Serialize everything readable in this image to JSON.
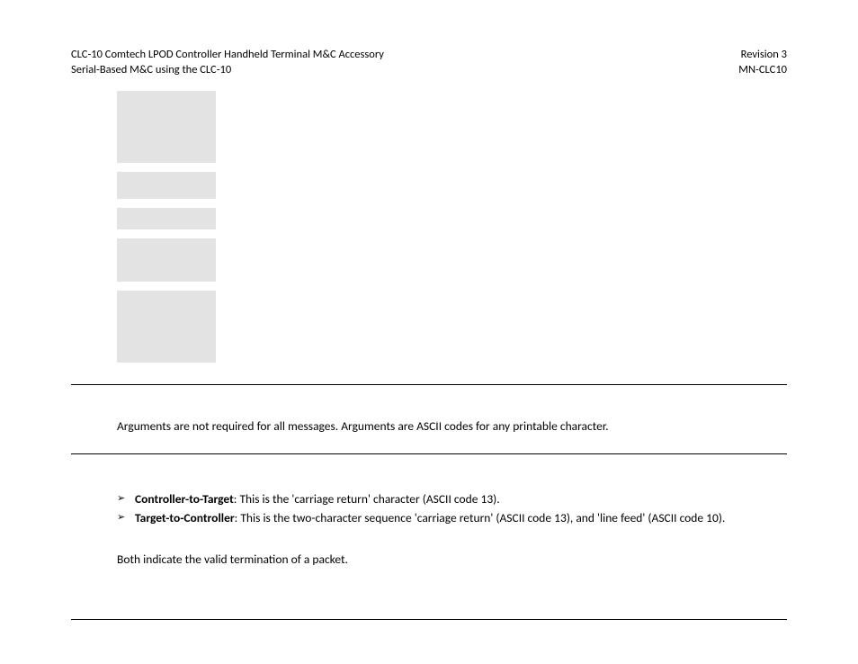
{
  "header": {
    "left_line1": "CLC-10 Comtech LPOD Controller Handheld Terminal M&C Accessory",
    "left_line2": "Serial-Based M&C using the CLC-10",
    "right_line1": "Revision 3",
    "right_line2": "MN-CLC10"
  },
  "arguments_text": "Arguments are not required for all messages. Arguments are ASCII codes for any printable character.",
  "bullets": [
    {
      "label": "Controller-to-Target",
      "text": ": This is the 'carriage return' character (ASCII code 13)."
    },
    {
      "label": "Target-to-Controller",
      "text": ": This is the two-character sequence 'carriage return' (ASCII code 13), and 'line feed' (ASCII code 10)."
    }
  ],
  "followup_text": "Both indicate the valid termination of a packet."
}
